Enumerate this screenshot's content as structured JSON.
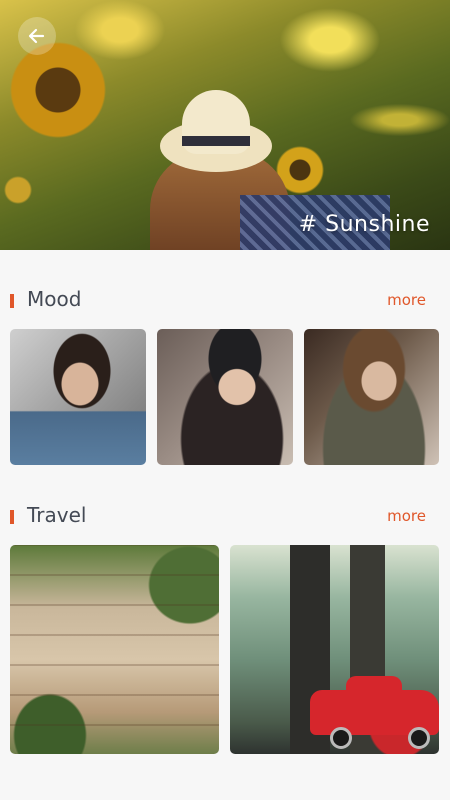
{
  "hero": {
    "tag": "# Sunshine",
    "back_icon": "arrow-left-icon"
  },
  "sections": [
    {
      "title": "Mood",
      "more_label": "more",
      "photos": [
        "mood-photo-1",
        "mood-photo-2",
        "mood-photo-3"
      ]
    },
    {
      "title": "Travel",
      "more_label": "more",
      "photos": [
        "travel-photo-1",
        "travel-photo-2"
      ]
    }
  ],
  "colors": {
    "accent": "#e0572a",
    "title_text": "#444a55",
    "background": "#f7f7f7"
  }
}
